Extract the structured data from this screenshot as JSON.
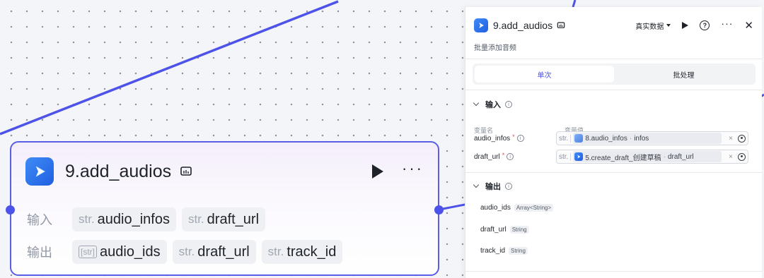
{
  "node": {
    "title": "9.add_audios",
    "icons": {
      "logo": "play-logo-icon",
      "badge": "test-tube-icon",
      "run": "play-icon",
      "more": "more-icon"
    },
    "input_label": "输入",
    "output_label": "输出",
    "inputs": [
      {
        "type": "str.",
        "name": "audio_infos"
      },
      {
        "type": "str.",
        "name": "draft_url"
      }
    ],
    "outputs": [
      {
        "type": "[str]",
        "name": "audio_ids"
      },
      {
        "type": "str.",
        "name": "draft_url"
      },
      {
        "type": "str.",
        "name": "track_id"
      }
    ]
  },
  "panel": {
    "title": "9.add_audios",
    "description": "批量添加音频",
    "data_mode": "真实数据",
    "more": "···",
    "close": "✕",
    "help": "?",
    "tabs": [
      {
        "label": "单次",
        "active": true
      },
      {
        "label": "批处理",
        "active": false
      }
    ],
    "input_section": {
      "title": "输入",
      "col_name": "变量名",
      "col_value": "变量值",
      "fields": [
        {
          "name": "audio_infos",
          "required": "*",
          "type": "str.",
          "ref_node": "8.audio_infos",
          "ref_sep": "·",
          "ref_var": "infos",
          "clear": "×"
        },
        {
          "name": "draft_url",
          "required": "*",
          "type": "str.",
          "ref_node": "5.create_draft_创建草稿",
          "ref_sep": "·",
          "ref_var": "draft_url",
          "clear": "×"
        }
      ]
    },
    "output_section": {
      "title": "输出",
      "fields": [
        {
          "name": "audio_ids",
          "type": "Array<String>"
        },
        {
          "name": "draft_url",
          "type": "String"
        },
        {
          "name": "track_id",
          "type": "String"
        }
      ]
    }
  },
  "colors": {
    "accent": "#4d53e8",
    "node_border": "#5a5ee6",
    "logo_blue": "#2b72ee"
  }
}
